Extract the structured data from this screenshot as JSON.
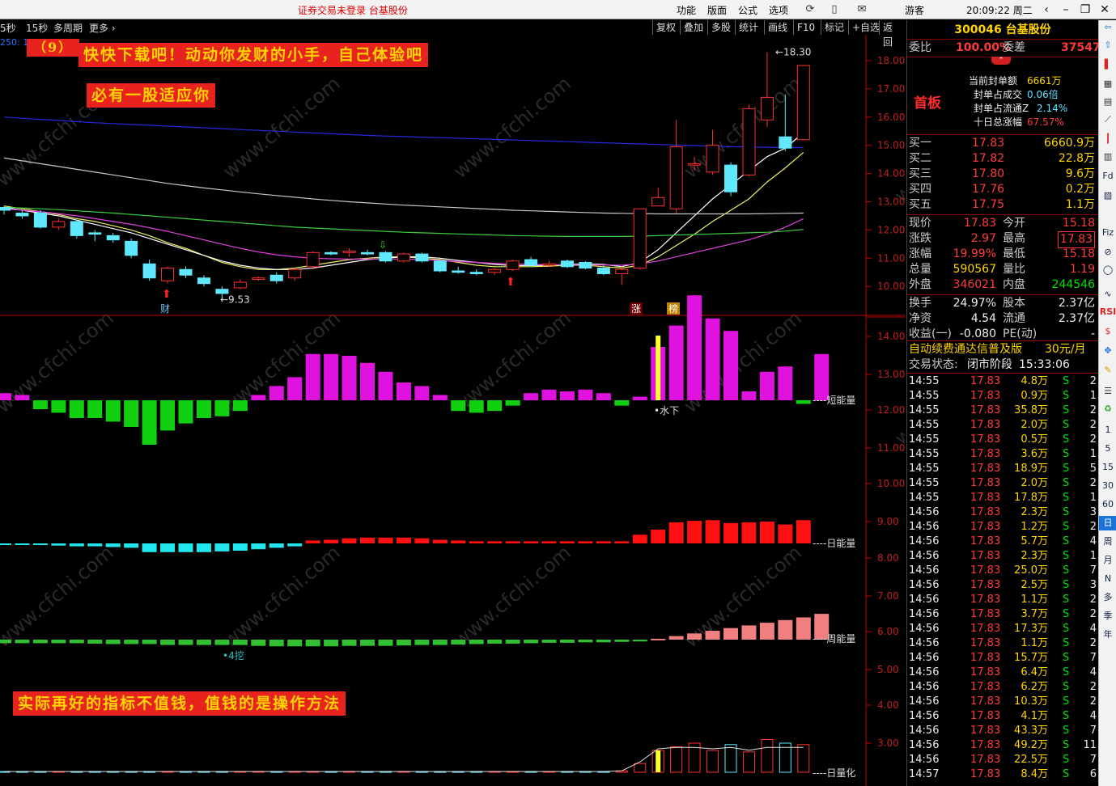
{
  "topbar": {
    "status": "证券交易未登录  台基股份",
    "menus": [
      "功能",
      "版面",
      "公式",
      "选项"
    ],
    "user": "游客",
    "clock": "20:09:22 周二"
  },
  "toolbar": {
    "periods": [
      "5秒",
      "15秒",
      "多周期",
      "更多 ›"
    ],
    "tools": [
      "复权",
      "叠加",
      "多股",
      "统计",
      "画线",
      "F10",
      "标记",
      "+自选",
      "返回"
    ],
    "partial_label": "250: 1"
  },
  "banners": {
    "top_number": "（9）",
    "line1": "快快下载吧！动动你发财的小手，自己体验吧",
    "line2": "必有一股适应你",
    "bottom": "实际再好的指标不值钱，值钱的是操作方法"
  },
  "watermark": "www.cfchi.com",
  "main_chart": {
    "y_ticks": [
      "18.00",
      "17.00",
      "16.00",
      "15.00",
      "14.00",
      "13.00",
      "12.00",
      "11.00",
      "10.00"
    ],
    "high_label": "18.30",
    "low_label": "9.53",
    "markers": {
      "cai": "财",
      "zhang": "涨",
      "bang": "榜"
    }
  },
  "lower_chart": {
    "y_ticks": [
      "14.00",
      "13.00",
      "12.00",
      "11.00",
      "10.00",
      "9.00",
      "8.00",
      "7.00",
      "6.00",
      "5.00",
      "4.00",
      "3.00"
    ],
    "labels": {
      "short": "短能量",
      "day": "日能量",
      "week": "周能量",
      "vol": "日量化",
      "water": "水下",
      "dig": "4挖"
    }
  },
  "chart_data": {
    "type": "candlestick",
    "y_range": [
      9.5,
      18.4
    ],
    "candles": [
      {
        "o": 12.8,
        "c": 12.7,
        "h": 12.85,
        "l": 12.55
      },
      {
        "o": 12.6,
        "c": 12.5,
        "h": 12.7,
        "l": 12.4
      },
      {
        "o": 12.6,
        "c": 12.1,
        "h": 12.7,
        "l": 12.05
      },
      {
        "o": 12.1,
        "c": 12.3,
        "h": 12.4,
        "l": 12.0
      },
      {
        "o": 12.3,
        "c": 11.8,
        "h": 12.35,
        "l": 11.7
      },
      {
        "o": 11.9,
        "c": 11.85,
        "h": 12.0,
        "l": 11.6
      },
      {
        "o": 11.8,
        "c": 11.65,
        "h": 11.9,
        "l": 11.55
      },
      {
        "o": 11.6,
        "c": 11.1,
        "h": 11.7,
        "l": 11.0
      },
      {
        "o": 10.8,
        "c": 10.3,
        "h": 10.95,
        "l": 10.2
      },
      {
        "o": 10.2,
        "c": 10.65,
        "h": 10.7,
        "l": 10.1
      },
      {
        "o": 10.6,
        "c": 10.4,
        "h": 10.7,
        "l": 10.3
      },
      {
        "o": 10.3,
        "c": 10.1,
        "h": 10.4,
        "l": 10.0
      },
      {
        "o": 9.9,
        "c": 9.75,
        "h": 10.0,
        "l": 9.53
      },
      {
        "o": 9.95,
        "c": 10.15,
        "h": 10.25,
        "l": 9.9
      },
      {
        "o": 10.25,
        "c": 10.3,
        "h": 10.35,
        "l": 10.2
      },
      {
        "o": 10.4,
        "c": 10.2,
        "h": 10.5,
        "l": 10.1
      },
      {
        "o": 10.3,
        "c": 10.6,
        "h": 10.65,
        "l": 10.2
      },
      {
        "o": 10.7,
        "c": 11.2,
        "h": 11.25,
        "l": 10.6
      },
      {
        "o": 11.2,
        "c": 11.15,
        "h": 11.25,
        "l": 11.1
      },
      {
        "o": 11.2,
        "c": 11.25,
        "h": 11.35,
        "l": 11.05
      },
      {
        "o": 11.2,
        "c": 11.15,
        "h": 11.3,
        "l": 11.1
      },
      {
        "o": 11.2,
        "c": 10.9,
        "h": 11.25,
        "l": 10.85
      },
      {
        "o": 10.9,
        "c": 11.15,
        "h": 11.2,
        "l": 10.85
      },
      {
        "o": 11.15,
        "c": 10.9,
        "h": 11.2,
        "l": 10.85
      },
      {
        "o": 10.9,
        "c": 10.55,
        "h": 10.95,
        "l": 10.5
      },
      {
        "o": 10.55,
        "c": 10.5,
        "h": 10.7,
        "l": 10.45
      },
      {
        "o": 10.5,
        "c": 10.45,
        "h": 10.6,
        "l": 10.4
      },
      {
        "o": 10.5,
        "c": 10.6,
        "h": 10.65,
        "l": 10.4
      },
      {
        "o": 10.6,
        "c": 10.9,
        "h": 10.95,
        "l": 10.55
      },
      {
        "o": 10.95,
        "c": 10.75,
        "h": 11.05,
        "l": 10.7
      },
      {
        "o": 10.75,
        "c": 10.8,
        "h": 10.9,
        "l": 10.7
      },
      {
        "o": 10.9,
        "c": 10.7,
        "h": 10.95,
        "l": 10.65
      },
      {
        "o": 10.85,
        "c": 10.65,
        "h": 10.9,
        "l": 10.6
      },
      {
        "o": 10.65,
        "c": 10.45,
        "h": 10.75,
        "l": 10.4
      },
      {
        "o": 10.45,
        "c": 10.6,
        "h": 10.7,
        "l": 10.05
      },
      {
        "o": 10.65,
        "c": 12.75,
        "h": 12.75,
        "l": 10.6
      },
      {
        "o": 12.85,
        "c": 13.15,
        "h": 13.5,
        "l": 12.85
      },
      {
        "o": 12.75,
        "c": 14.95,
        "h": 15.9,
        "l": 12.6
      },
      {
        "o": 14.3,
        "c": 14.35,
        "h": 14.6,
        "l": 14.1
      },
      {
        "o": 14.05,
        "c": 15.0,
        "h": 15.55,
        "l": 13.95
      },
      {
        "o": 14.3,
        "c": 13.35,
        "h": 14.4,
        "l": 13.2
      },
      {
        "o": 13.95,
        "c": 16.3,
        "h": 16.45,
        "l": 13.9
      },
      {
        "o": 15.9,
        "c": 16.7,
        "h": 18.3,
        "l": 15.65
      },
      {
        "o": 15.3,
        "c": 14.9,
        "h": 16.8,
        "l": 14.8
      },
      {
        "o": 15.2,
        "c": 17.83,
        "h": 17.83,
        "l": 15.18
      }
    ],
    "series": [
      {
        "color": "#f0f060",
        "values": [
          12.85,
          12.75,
          12.65,
          12.55,
          12.4,
          12.3,
          12.15,
          12.0,
          11.8,
          11.55,
          11.35,
          11.1,
          10.85,
          10.7,
          10.6,
          10.6,
          10.65,
          10.75,
          10.85,
          10.95,
          11.0,
          11.05,
          11.05,
          11.0,
          10.95,
          10.85,
          10.75,
          10.7,
          10.7,
          10.7,
          10.72,
          10.75,
          10.75,
          10.7,
          10.65,
          10.75,
          11.05,
          11.45,
          11.85,
          12.3,
          12.7,
          13.1,
          13.7,
          14.2,
          14.75
        ]
      },
      {
        "color": "#ffffff",
        "values": [
          12.8,
          12.7,
          12.6,
          12.5,
          12.35,
          12.2,
          12.05,
          11.9,
          11.7,
          11.5,
          11.3,
          11.1,
          10.9,
          10.75,
          10.65,
          10.6,
          10.6,
          10.65,
          10.75,
          10.85,
          10.95,
          11.0,
          11.05,
          11.05,
          11.0,
          10.92,
          10.85,
          10.78,
          10.74,
          10.74,
          10.75,
          10.78,
          10.8,
          10.78,
          10.7,
          10.85,
          11.3,
          11.9,
          12.5,
          13.1,
          13.6,
          14.1,
          14.6,
          14.9,
          15.45
        ]
      },
      {
        "color": "#e040e0",
        "values": [
          12.75,
          12.7,
          12.65,
          12.58,
          12.5,
          12.4,
          12.3,
          12.2,
          12.08,
          11.95,
          11.8,
          11.65,
          11.5,
          11.35,
          11.22,
          11.12,
          11.05,
          11.0,
          10.98,
          10.97,
          10.97,
          10.97,
          10.97,
          10.95,
          10.92,
          10.88,
          10.85,
          10.82,
          10.8,
          10.78,
          10.77,
          10.76,
          10.76,
          10.76,
          10.75,
          10.8,
          10.9,
          11.05,
          11.2,
          11.35,
          11.5,
          11.65,
          11.85,
          12.1,
          12.4
        ]
      },
      {
        "color": "#3ccf3c",
        "values": [
          12.8,
          12.78,
          12.75,
          12.72,
          12.68,
          12.64,
          12.6,
          12.55,
          12.5,
          12.45,
          12.4,
          12.35,
          12.3,
          12.25,
          12.2,
          12.15,
          12.1,
          12.07,
          12.04,
          12.01,
          11.98,
          11.95,
          11.92,
          11.9,
          11.88,
          11.86,
          11.84,
          11.82,
          11.8,
          11.79,
          11.78,
          11.77,
          11.77,
          11.77,
          11.77,
          11.78,
          11.8,
          11.82,
          11.84,
          11.86,
          11.88,
          11.9,
          11.92,
          11.96,
          12.02
        ]
      },
      {
        "color": "#c8c8c8",
        "values": [
          14.55,
          14.45,
          14.35,
          14.25,
          14.15,
          14.05,
          13.95,
          13.85,
          13.75,
          13.65,
          13.57,
          13.49,
          13.42,
          13.35,
          13.28,
          13.22,
          13.16,
          13.1,
          13.05,
          13.0,
          12.96,
          12.92,
          12.88,
          12.85,
          12.82,
          12.79,
          12.76,
          12.73,
          12.7,
          12.68,
          12.66,
          12.64,
          12.62,
          12.6,
          12.59,
          12.58,
          12.57,
          12.57,
          12.57,
          12.57,
          12.57,
          12.57,
          12.58,
          12.59,
          12.6
        ]
      },
      {
        "color": "#2828e0",
        "values": [
          16.0,
          15.96,
          15.92,
          15.88,
          15.84,
          15.8,
          15.77,
          15.74,
          15.71,
          15.68,
          15.65,
          15.62,
          15.59,
          15.56,
          15.53,
          15.5,
          15.47,
          15.44,
          15.41,
          15.38,
          15.35,
          15.33,
          15.31,
          15.29,
          15.27,
          15.25,
          15.23,
          15.21,
          15.19,
          15.17,
          15.15,
          15.13,
          15.11,
          15.09,
          15.07,
          15.05,
          15.03,
          15.01,
          14.99,
          14.97,
          14.95,
          14.94,
          14.93,
          14.92,
          14.92
        ]
      }
    ],
    "short_energy": [
      0.4,
      0.3,
      -0.5,
      -0.7,
      -1.0,
      -1.0,
      -1.2,
      -1.5,
      -2.5,
      -1.7,
      -1.3,
      -1.0,
      -0.9,
      -0.6,
      0.3,
      0.8,
      1.3,
      2.6,
      2.6,
      2.5,
      2.1,
      1.6,
      1.0,
      0.8,
      0.3,
      -0.6,
      -0.7,
      -0.6,
      -0.3,
      0.4,
      0.6,
      0.5,
      0.6,
      0.4,
      -0.3,
      0.2,
      3.0,
      4.2,
      5.9,
      4.6,
      3.9,
      0.5,
      1.6,
      1.9,
      -0.2,
      2.6
    ],
    "day_energy": [
      -0.2,
      -0.2,
      -0.2,
      -0.3,
      -0.4,
      -0.4,
      -0.5,
      -0.6,
      -1.2,
      -1.2,
      -1.2,
      -1.2,
      -1.1,
      -1.0,
      -0.8,
      -0.6,
      -0.4,
      0.4,
      0.5,
      0.7,
      0.8,
      0.8,
      0.8,
      0.7,
      0.5,
      0.4,
      0.3,
      0.3,
      0.3,
      0.3,
      0.3,
      0.3,
      0.3,
      0.3,
      0.3,
      1.2,
      1.9,
      2.9,
      3.1,
      3.2,
      2.8,
      2.9,
      3.0,
      2.6,
      3.2
    ],
    "week_energy": [
      -0.4,
      -0.4,
      -0.4,
      -0.4,
      -0.4,
      -0.45,
      -0.5,
      -0.5,
      -0.5,
      -0.6,
      -0.6,
      -0.6,
      -0.6,
      -0.6,
      -0.7,
      -0.75,
      -0.75,
      -0.75,
      -0.75,
      -0.7,
      -0.7,
      -0.7,
      -0.65,
      -0.6,
      -0.6,
      -0.55,
      -0.5,
      -0.45,
      -0.45,
      -0.4,
      -0.35,
      -0.35,
      -0.3,
      -0.3,
      -0.25,
      -0.2,
      0.1,
      0.4,
      0.7,
      1.0,
      1.3,
      1.6,
      1.9,
      2.2,
      2.5,
      2.9
    ],
    "volume": [
      0.1,
      0.1,
      0.1,
      0.1,
      0.1,
      0.1,
      0.1,
      0.1,
      0.1,
      0.1,
      0.1,
      0.1,
      0.1,
      0.1,
      0.1,
      0.1,
      0.1,
      0.1,
      0.1,
      0.1,
      0.1,
      0.1,
      0.1,
      0.1,
      0.1,
      0.1,
      0.1,
      0.1,
      0.1,
      0.1,
      0.1,
      0.1,
      0.1,
      0.1,
      0.2,
      1.2,
      3.0,
      3.5,
      4.0,
      3.0,
      3.8,
      2.8,
      4.5,
      4.0,
      3.8
    ]
  },
  "quote": {
    "code_name": "300046 台基股份",
    "weibi_label": "委比",
    "weibi_value": "100.00%",
    "weicha_label": "委差",
    "weicha_value": "37547",
    "first_board": "首板",
    "seal_amount_label": "当前封单额",
    "seal_amount": "6661万",
    "seal_vol_label": "封单占成交",
    "seal_vol": "0.06倍",
    "seal_float_label": "封单占流通Z",
    "seal_float": "2.14%",
    "ten_day_label": "十日总涨幅",
    "ten_day": "67.57%",
    "bids": [
      {
        "label": "买一",
        "price": "17.83",
        "vol": "6660.9万"
      },
      {
        "label": "买二",
        "price": "17.82",
        "vol": "22.8万"
      },
      {
        "label": "买三",
        "price": "17.80",
        "vol": "9.6万"
      },
      {
        "label": "买四",
        "price": "17.76",
        "vol": "0.2万"
      },
      {
        "label": "买五",
        "price": "17.75",
        "vol": "1.1万"
      }
    ],
    "stats": [
      {
        "l1": "现价",
        "v1": "17.83",
        "l2": "今开",
        "v2": "15.18"
      },
      {
        "l1": "涨跌",
        "v1": "2.97",
        "l2": "最高",
        "v2": "17.83"
      },
      {
        "l1": "涨幅",
        "v1": "19.99%",
        "l2": "最低",
        "v2": "15.18"
      },
      {
        "l1": "总量",
        "v1": "590567",
        "l2": "量比",
        "v2": "1.19"
      },
      {
        "l1": "外盘",
        "v1": "346021",
        "l2": "内盘",
        "v2": "244546"
      }
    ],
    "fin": [
      {
        "l1": "换手",
        "v1": "24.97%",
        "l2": "股本",
        "v2": "2.37亿"
      },
      {
        "l1": "净资",
        "v1": "4.54",
        "l2": "流通",
        "v2": "2.37亿"
      },
      {
        "l1": "收益(一)",
        "v1": "-0.080",
        "l2": "PE(动)",
        "v2": "-"
      }
    ],
    "ad_text": "自动续费通达信普及版",
    "ad_price": "30元/月",
    "trade_state_label": "交易状态:",
    "trade_state": "闭市阶段",
    "trade_time": "15:33:06"
  },
  "ticks": [
    {
      "t": "14:55",
      "p": "17.83",
      "v": "4.8万",
      "s": "S",
      "n": "2"
    },
    {
      "t": "14:55",
      "p": "17.83",
      "v": "0.9万",
      "s": "S",
      "n": "1"
    },
    {
      "t": "14:55",
      "p": "17.83",
      "v": "35.8万",
      "s": "S",
      "n": "2"
    },
    {
      "t": "14:55",
      "p": "17.83",
      "v": "2.0万",
      "s": "S",
      "n": "2"
    },
    {
      "t": "14:55",
      "p": "17.83",
      "v": "0.5万",
      "s": "S",
      "n": "2"
    },
    {
      "t": "14:55",
      "p": "17.83",
      "v": "3.6万",
      "s": "S",
      "n": "1"
    },
    {
      "t": "14:55",
      "p": "17.83",
      "v": "18.9万",
      "s": "S",
      "n": "5"
    },
    {
      "t": "14:55",
      "p": "17.83",
      "v": "2.0万",
      "s": "S",
      "n": "2"
    },
    {
      "t": "14:55",
      "p": "17.83",
      "v": "17.8万",
      "s": "S",
      "n": "1"
    },
    {
      "t": "14:56",
      "p": "17.83",
      "v": "2.3万",
      "s": "S",
      "n": "3"
    },
    {
      "t": "14:56",
      "p": "17.83",
      "v": "1.2万",
      "s": "S",
      "n": "2"
    },
    {
      "t": "14:56",
      "p": "17.83",
      "v": "5.7万",
      "s": "S",
      "n": "4"
    },
    {
      "t": "14:56",
      "p": "17.83",
      "v": "2.3万",
      "s": "S",
      "n": "1"
    },
    {
      "t": "14:56",
      "p": "17.83",
      "v": "25.0万",
      "s": "S",
      "n": "7"
    },
    {
      "t": "14:56",
      "p": "17.83",
      "v": "2.5万",
      "s": "S",
      "n": "3"
    },
    {
      "t": "14:56",
      "p": "17.83",
      "v": "1.1万",
      "s": "S",
      "n": "2"
    },
    {
      "t": "14:56",
      "p": "17.83",
      "v": "3.7万",
      "s": "S",
      "n": "2"
    },
    {
      "t": "14:56",
      "p": "17.83",
      "v": "17.3万",
      "s": "S",
      "n": "4"
    },
    {
      "t": "14:56",
      "p": "17.83",
      "v": "1.1万",
      "s": "S",
      "n": "2"
    },
    {
      "t": "14:56",
      "p": "17.83",
      "v": "15.7万",
      "s": "S",
      "n": "7"
    },
    {
      "t": "14:56",
      "p": "17.83",
      "v": "6.4万",
      "s": "S",
      "n": "4"
    },
    {
      "t": "14:56",
      "p": "17.83",
      "v": "6.2万",
      "s": "S",
      "n": "2"
    },
    {
      "t": "14:56",
      "p": "17.83",
      "v": "10.3万",
      "s": "S",
      "n": "2"
    },
    {
      "t": "14:56",
      "p": "17.83",
      "v": "4.1万",
      "s": "S",
      "n": "4"
    },
    {
      "t": "14:56",
      "p": "17.83",
      "v": "43.3万",
      "s": "S",
      "n": "7"
    },
    {
      "t": "14:56",
      "p": "17.83",
      "v": "49.2万",
      "s": "S",
      "n": "11"
    },
    {
      "t": "14:56",
      "p": "17.83",
      "v": "22.5万",
      "s": "S",
      "n": "7"
    },
    {
      "t": "14:57",
      "p": "17.83",
      "v": "8.4万",
      "s": "S",
      "n": "6"
    }
  ],
  "sidebar": [
    "1",
    "5",
    "15",
    "30",
    "60",
    "日",
    "周",
    "月",
    "N",
    "多",
    "季",
    "年"
  ]
}
